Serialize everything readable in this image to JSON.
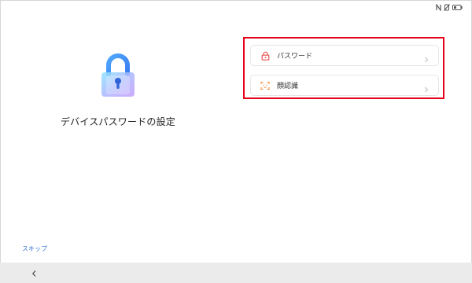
{
  "status_bar": {
    "icons": [
      "nfc-icon",
      "mute-icon",
      "battery-icon"
    ]
  },
  "main": {
    "title": "デバイスパスワードの設定",
    "illustration": "lock-icon"
  },
  "options": [
    {
      "label": "パスワード",
      "icon": "lock-icon",
      "icon_color": "#e8504f"
    },
    {
      "label": "顔認識",
      "icon": "face-scan-icon",
      "icon_color": "#f08a3c"
    }
  ],
  "footer": {
    "skip_label": "スキップ",
    "back_icon": "chevron-left-icon"
  },
  "colors": {
    "highlight_border": "#e3001b",
    "link": "#3a7bd5"
  }
}
